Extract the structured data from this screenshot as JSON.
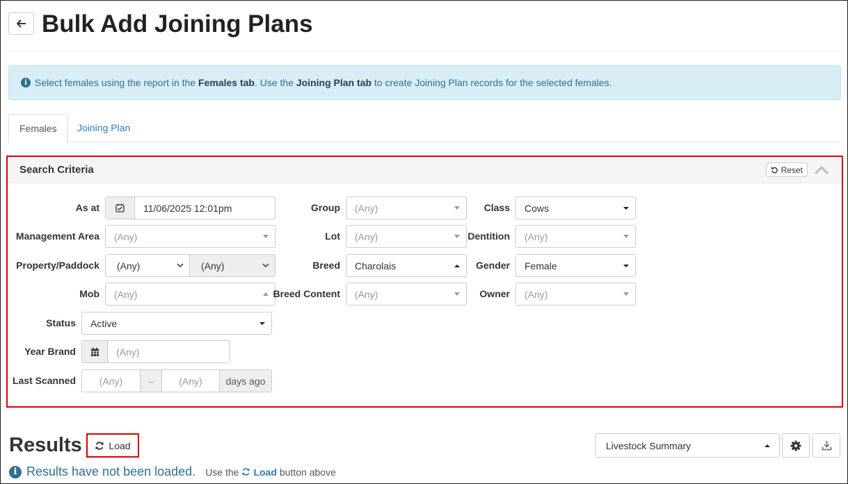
{
  "header": {
    "title": "Bulk Add Joining Plans"
  },
  "banner": {
    "text1": "Select females using the report in the ",
    "bold1": "Females tab",
    "text2": ". Use the ",
    "bold2": "Joining Plan tab",
    "text3": " to create Joining Plan records for the selected females."
  },
  "tabs": [
    {
      "label": "Females",
      "active": true
    },
    {
      "label": "Joining Plan",
      "active": false
    }
  ],
  "search": {
    "title": "Search Criteria",
    "reset_label": "Reset",
    "fields": {
      "as_at": {
        "label": "As at",
        "value": "11/06/2025 12:01pm"
      },
      "management_area": {
        "label": "Management Area",
        "placeholder": "(Any)"
      },
      "property_paddock": {
        "label": "Property/Paddock",
        "property": "(Any)",
        "paddock": "(Any)"
      },
      "mob": {
        "label": "Mob",
        "placeholder": "(Any)"
      },
      "status": {
        "label": "Status",
        "value": "Active"
      },
      "year_brand": {
        "label": "Year Brand",
        "placeholder": "(Any)"
      },
      "last_scanned": {
        "label": "Last Scanned",
        "from": "(Any)",
        "separator": "–",
        "to": "(Any)",
        "suffix": "days ago"
      },
      "group": {
        "label": "Group",
        "placeholder": "(Any)"
      },
      "lot": {
        "label": "Lot",
        "placeholder": "(Any)"
      },
      "breed": {
        "label": "Breed",
        "value": "Charolais"
      },
      "breed_content": {
        "label": "Breed Content",
        "placeholder": "(Any)"
      },
      "class": {
        "label": "Class",
        "value": "Cows"
      },
      "dentition": {
        "label": "Dentition",
        "placeholder": "(Any)"
      },
      "gender": {
        "label": "Gender",
        "value": "Female"
      },
      "owner": {
        "label": "Owner",
        "placeholder": "(Any)"
      }
    }
  },
  "results": {
    "title": "Results",
    "load_label": "Load",
    "report_select": "Livestock Summary",
    "not_loaded": "Results have not been loaded.",
    "hint_prefix": "Use the",
    "hint_bold": "Load",
    "hint_suffix": "button above"
  },
  "colors": {
    "accent": "#337ab7",
    "info": "#31708f",
    "highlight": "#dd0000",
    "banner_bg": "#d9edf7"
  }
}
